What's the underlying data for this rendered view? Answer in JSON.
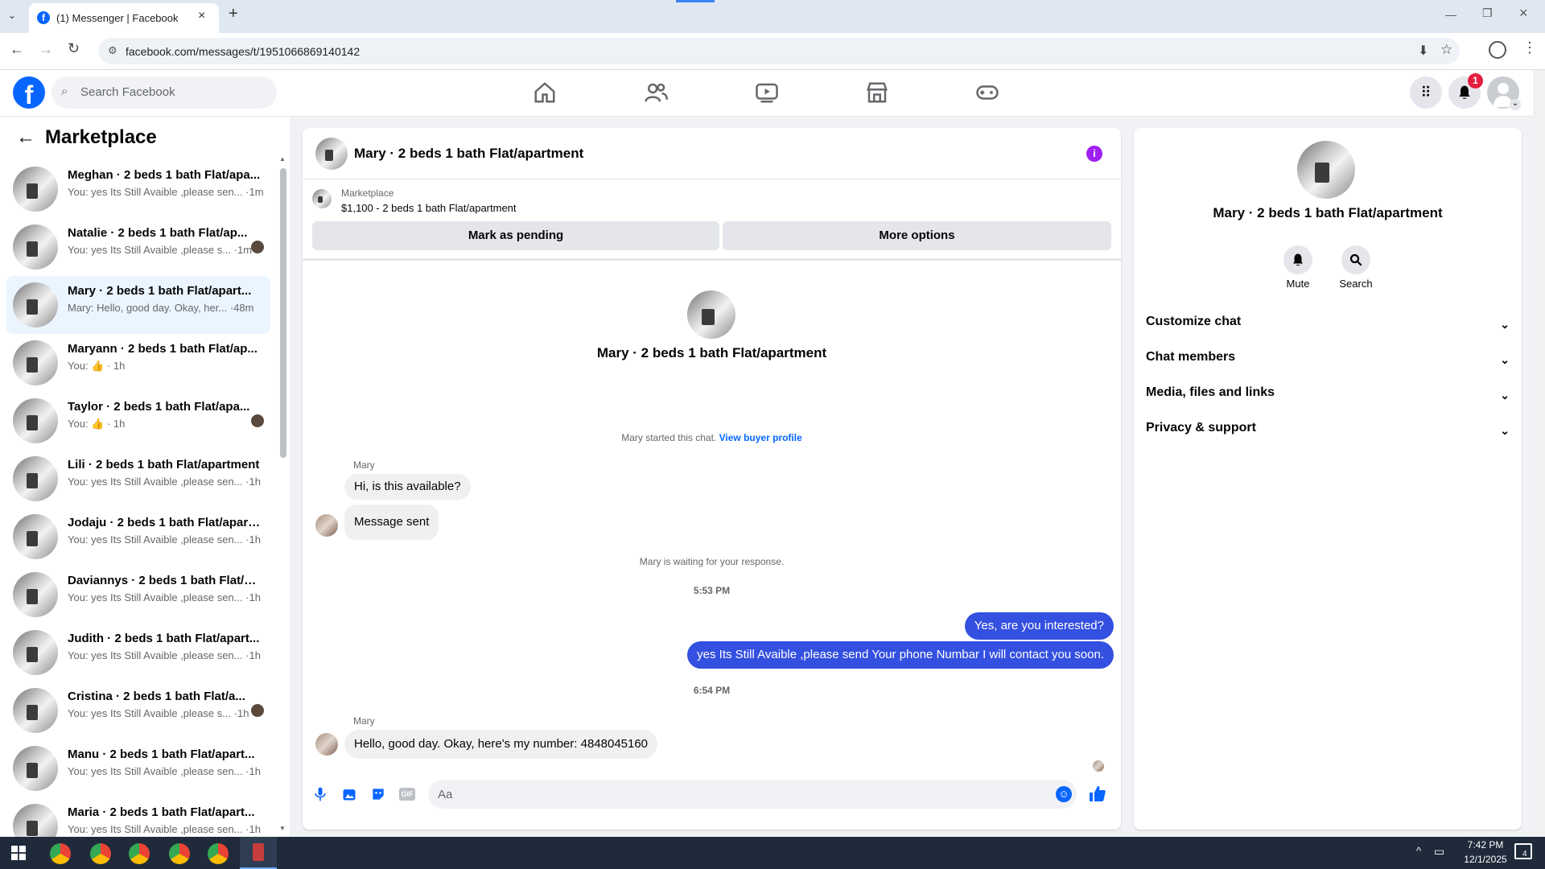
{
  "browser": {
    "tab_title": "(1) Messenger | Facebook",
    "url": "facebook.com/messages/t/1951066869140142"
  },
  "facebook_nav": {
    "search_placeholder": "Search Facebook",
    "notification_count": "1"
  },
  "sidebar": {
    "title": "Marketplace",
    "conversations": [
      {
        "name": "Meghan · 2 beds 1 bath Flat/apa...",
        "preview": "You: yes Its Still Avaible ,please sen... ·1m",
        "active": false,
        "mini": false
      },
      {
        "name": "Natalie · 2 beds 1 bath Flat/ap...",
        "preview": "You: yes Its Still Avaible ,please s... ·1m",
        "active": false,
        "mini": true
      },
      {
        "name": "Mary · 2 beds 1 bath Flat/apart...",
        "preview": "Mary: Hello, good day. Okay, her... ·48m",
        "active": true,
        "mini": false
      },
      {
        "name": "Maryann · 2 beds 1 bath Flat/ap...",
        "preview": "You: 👍 · 1h",
        "active": false,
        "mini": false
      },
      {
        "name": "Taylor · 2 beds 1 bath Flat/apa...",
        "preview": "You: 👍 · 1h",
        "active": false,
        "mini": true
      },
      {
        "name": "Lili · 2 beds 1 bath Flat/apartment",
        "preview": "You: yes Its Still Avaible ,please sen... ·1h",
        "active": false,
        "mini": false
      },
      {
        "name": "Jodaju · 2 beds 1 bath Flat/apart...",
        "preview": "You: yes Its Still Avaible ,please sen... ·1h",
        "active": false,
        "mini": false
      },
      {
        "name": "Daviannys · 2 beds 1 bath Flat/a...",
        "preview": "You: yes Its Still Avaible ,please sen... ·1h",
        "active": false,
        "mini": false
      },
      {
        "name": "Judith · 2 beds 1 bath Flat/apart...",
        "preview": "You: yes Its Still Avaible ,please sen... ·1h",
        "active": false,
        "mini": false
      },
      {
        "name": "Cristina · 2 beds 1 bath Flat/a...",
        "preview": "You: yes Its Still Avaible ,please s... ·1h",
        "active": false,
        "mini": true
      },
      {
        "name": "Manu · 2 beds 1 bath Flat/apart...",
        "preview": "You: yes Its Still Avaible ,please sen... ·1h",
        "active": false,
        "mini": false
      },
      {
        "name": "Maria · 2 beds 1 bath Flat/apart...",
        "preview": "You: yes Its Still Avaible ,please sen... ·1h",
        "active": false,
        "mini": false
      }
    ]
  },
  "chat": {
    "header_title": "Mary · 2 beds 1 bath Flat/apartment",
    "listing": {
      "source": "Marketplace",
      "detail": "$1,100 - 2 beds 1 bath Flat/apartment"
    },
    "mark_pending_label": "Mark as pending",
    "more_options_label": "More options",
    "profile_name": "Mary · 2 beds 1 bath Flat/apartment",
    "started_text": "Mary started this chat.",
    "view_buyer_profile": "View buyer profile",
    "sender_1": "Mary",
    "msg_1": "Hi, is this available?",
    "msg_2": "Message sent",
    "waiting_text": "Mary is waiting for your response.",
    "time_1": "5:53 PM",
    "mine_1": "Yes, are you interested?",
    "mine_2": "yes Its Still Avaible ,please send Your phone Numbar I will contact you soon.",
    "time_2": "6:54 PM",
    "sender_2": "Mary",
    "msg_3": "Hello, good day. Okay, here's my number: 4848045160",
    "composer_placeholder": "Aa"
  },
  "details": {
    "name": "Mary · 2 beds 1 bath Flat/apartment",
    "mute_label": "Mute",
    "search_label": "Search",
    "rows": [
      "Customize chat",
      "Chat members",
      "Media, files and links",
      "Privacy & support"
    ]
  },
  "taskbar": {
    "time": "7:42 PM",
    "date": "12/1/2025",
    "notif_count": "4"
  },
  "colors": {
    "fb_blue": "#0866ff",
    "bubble_blue": "#3450e0",
    "info_purple": "#a020f0"
  }
}
